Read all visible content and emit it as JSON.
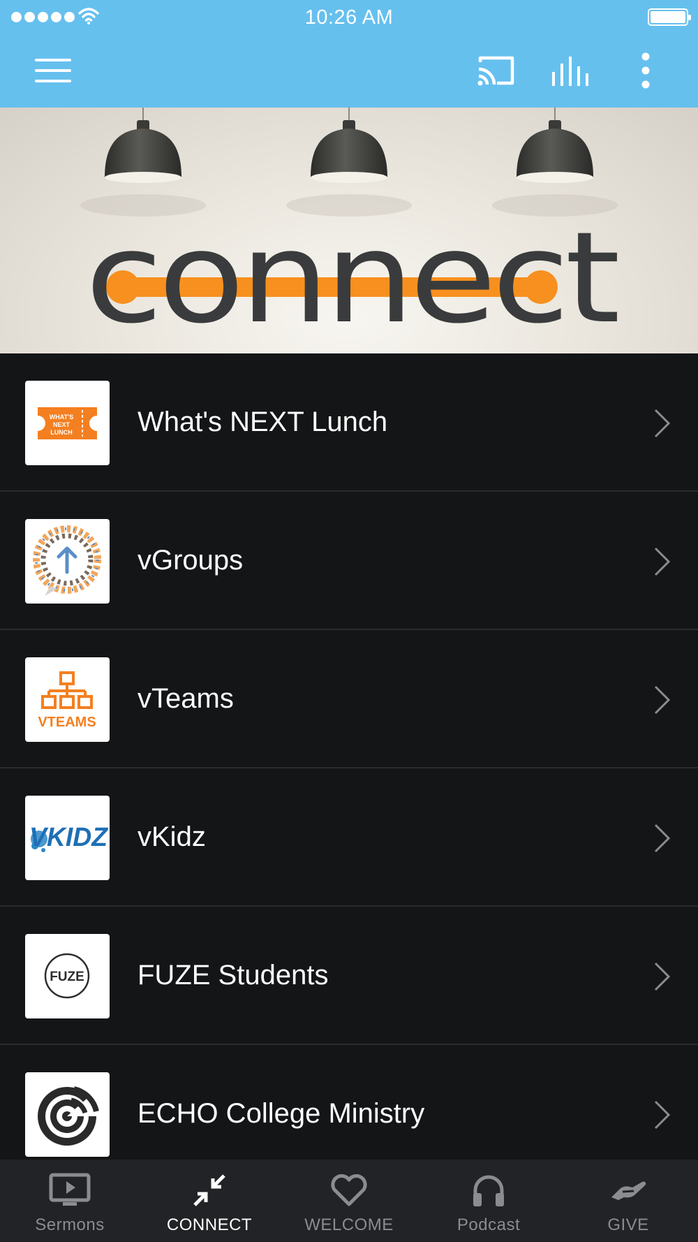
{
  "status_bar": {
    "time": "10:26 AM"
  },
  "header": {
    "menu_icon": "hamburger-menu-icon",
    "cast_icon": "cast-icon",
    "audio_icon": "equalizer-bars-icon",
    "more_icon": "more-vertical-icon"
  },
  "hero": {
    "title": "connect",
    "accent_color": "#f7901e"
  },
  "list": {
    "items": [
      {
        "label": "What's NEXT Lunch",
        "thumb_text": "WHAT'S NEXT LUNCH"
      },
      {
        "label": "vGroups"
      },
      {
        "label": "vTeams",
        "thumb_text": "VTEAMS"
      },
      {
        "label": "vKidz",
        "thumb_text": "VKIDZ"
      },
      {
        "label": "FUZE Students",
        "thumb_text": "FUZE"
      },
      {
        "label": "ECHO College Ministry"
      }
    ]
  },
  "tabbar": {
    "tabs": [
      {
        "label": "Sermons",
        "icon": "tv-play-icon",
        "active": false
      },
      {
        "label": "CONNECT",
        "icon": "arrows-in-icon",
        "active": true
      },
      {
        "label": "WELCOME",
        "icon": "heart-icon",
        "active": false
      },
      {
        "label": "Podcast",
        "icon": "headphones-icon",
        "active": false
      },
      {
        "label": "GIVE",
        "icon": "giving-hand-icon",
        "active": false
      }
    ]
  },
  "colors": {
    "header_bg": "#66c0ee",
    "list_bg": "#141517",
    "tabbar_bg": "#222326",
    "accent_orange": "#f7901e"
  }
}
